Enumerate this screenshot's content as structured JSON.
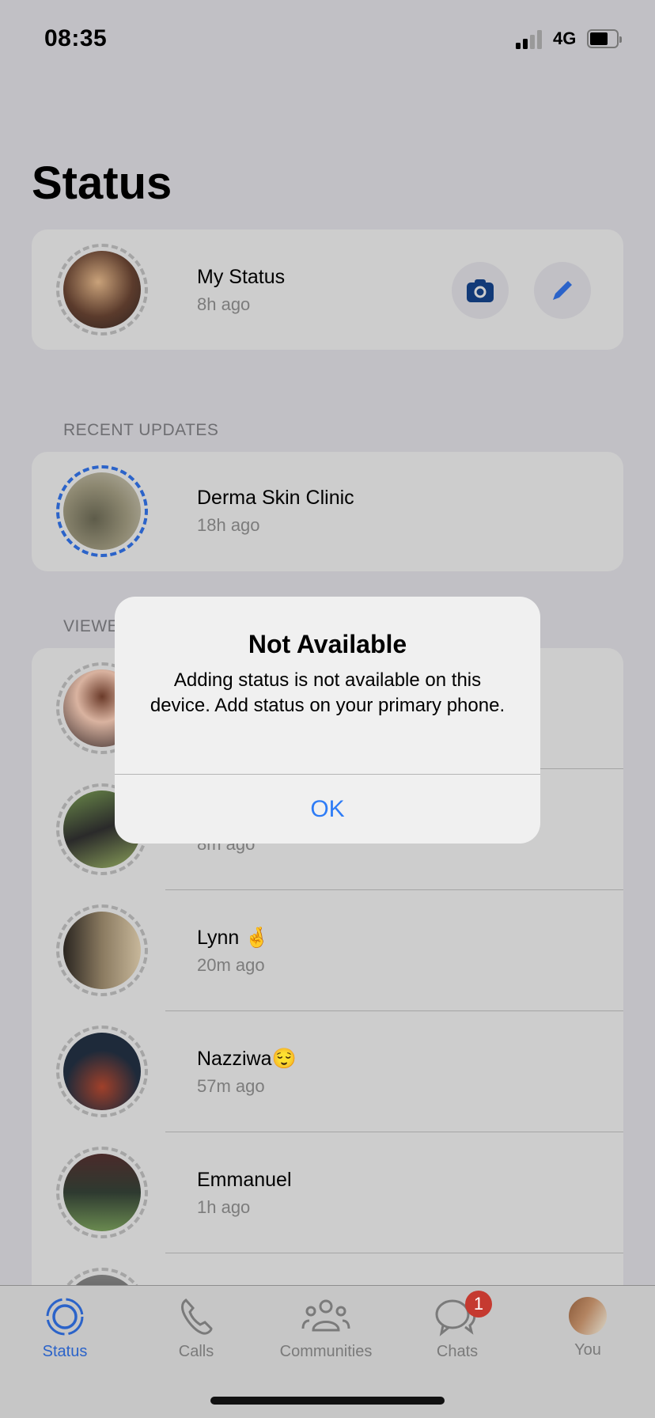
{
  "status_bar": {
    "time": "08:35",
    "network": "4G",
    "battery_level": 0.7,
    "signal_bars": 2
  },
  "page_title": "Status",
  "my_status": {
    "name": "My Status",
    "time": "8h ago",
    "camera_icon": "camera-icon",
    "pencil_icon": "pencil-icon"
  },
  "recent": {
    "label": "RECENT UPDATES",
    "items": [
      {
        "name": "Derma Skin Clinic",
        "time": "18h ago"
      }
    ]
  },
  "viewed": {
    "label": "VIEWED UPDATES",
    "items": [
      {
        "name": "",
        "time": ""
      },
      {
        "name": "",
        "time": "8m ago"
      },
      {
        "name": "Lynn 🤞",
        "time": "20m ago"
      },
      {
        "name": "Nazziwa😌",
        "time": "57m ago"
      },
      {
        "name": "Emmanuel",
        "time": "1h ago"
      },
      {
        "name": "",
        "time": ""
      }
    ]
  },
  "dialog": {
    "title": "Not Available",
    "message": "Adding status is not available on this device. Add status on your primary phone.",
    "ok_label": "OK"
  },
  "tabs": [
    {
      "label": "Status",
      "active": true
    },
    {
      "label": "Calls"
    },
    {
      "label": "Communities"
    },
    {
      "label": "Chats",
      "badge": "1"
    },
    {
      "label": "You"
    }
  ],
  "colors": {
    "accent": "#2b63c9",
    "badge": "#c53a30",
    "ok": "#2e7cf6"
  }
}
